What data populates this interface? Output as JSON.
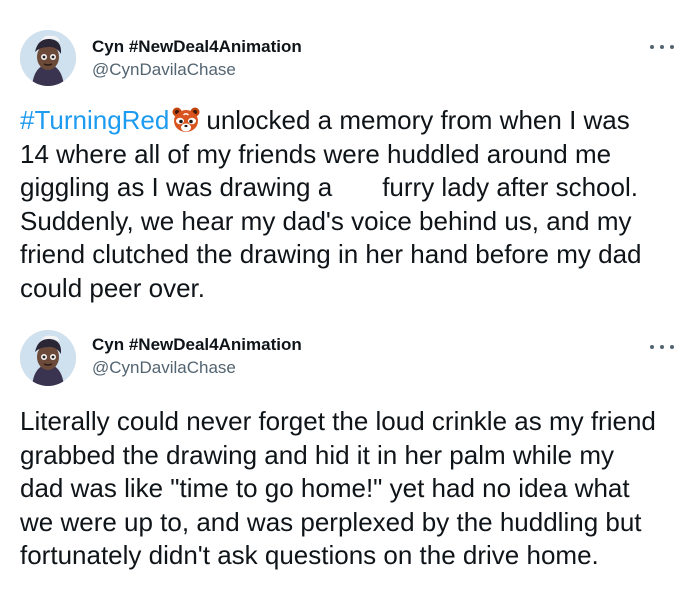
{
  "tweets": [
    {
      "author": {
        "name": "Cyn #NewDeal4Animation",
        "handle": "@CynDavilaChase"
      },
      "more_icon": "more-horizontal-icon",
      "hashtag": "#TurningRed",
      "emoji": "red-panda-emoji",
      "lines": [
        "unlocked a memory from when I was",
        "14 where all of my friends were huddled around me",
        "giggling as I was drawing a",
        "furry lady after school.",
        "Suddenly, we hear my dad's voice behind us, and my",
        "friend clutched the drawing in her hand before my dad",
        "could peer over."
      ]
    },
    {
      "author": {
        "name": "Cyn #NewDeal4Animation",
        "handle": "@CynDavilaChase"
      },
      "more_icon": "more-horizontal-icon",
      "lines": [
        "Literally could never forget the loud crinkle as my friend",
        "grabbed the drawing and hid it in her palm while my",
        "dad was like \"time to go home!\" yet had no idea what",
        "we were up to, and was perplexed by the huddling but",
        "fortunately didn't ask questions on the drive home."
      ]
    }
  ],
  "colors": {
    "hashtag": "#1d9bf0",
    "text": "#0f1419",
    "secondary": "#536471"
  }
}
